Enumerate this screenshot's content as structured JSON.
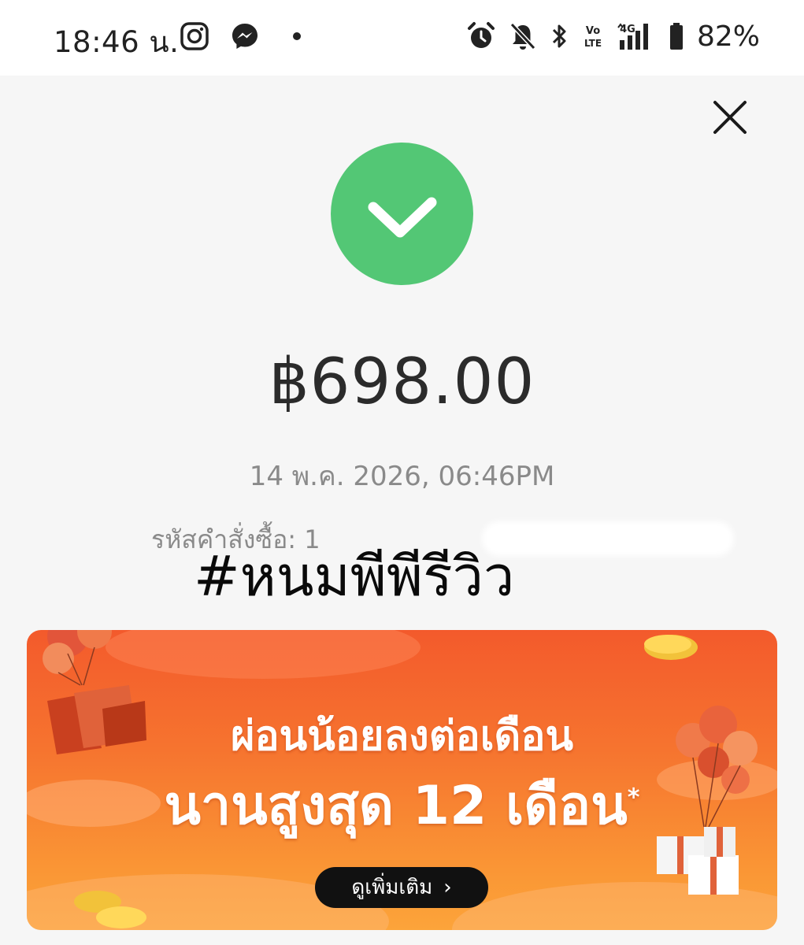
{
  "status_bar": {
    "time": "18:46 น.",
    "battery_percent": "82%",
    "left_icons": [
      "instagram-icon",
      "messenger-icon",
      "dot-icon"
    ],
    "right_icons": [
      "alarm-icon",
      "bell-muted-icon",
      "bluetooth-icon",
      "volte-icon",
      "signal-4g-icon",
      "battery-icon"
    ],
    "network_label": "4G",
    "volte_label": "Vo LTE"
  },
  "payment": {
    "status_icon": "check-circle-icon",
    "status_color": "#53c775",
    "amount": "฿698.00",
    "datetime": "14 พ.ค. 2026, 06:46PM",
    "order_id_label": "รหัสคำสั่งซื้อ: 1"
  },
  "overlay": {
    "hashtag": "#หนมพีพีรีวิว"
  },
  "promo": {
    "line1": "ผ่อนน้อยลงต่อเดือน",
    "line2": "นานสูงสุด 12 เดือน",
    "line2_mark": "*",
    "cta_label": "ดูเพิ่มเติม",
    "cta_chevron": "›",
    "accent_color": "#f35a2c"
  }
}
